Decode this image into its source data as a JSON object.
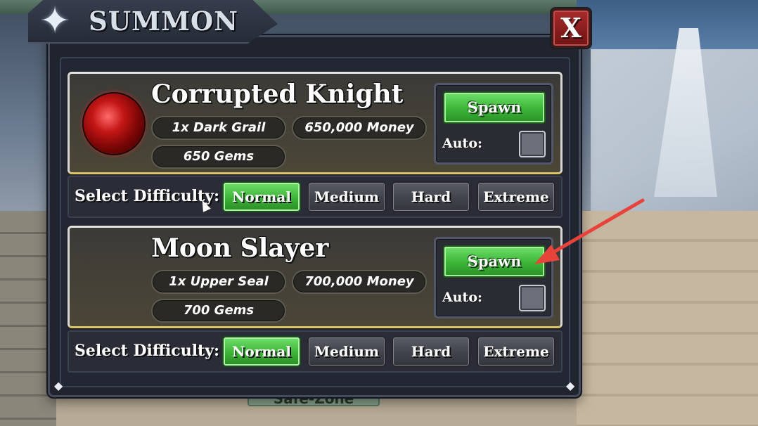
{
  "window": {
    "title": "SUMMON",
    "close_label": "X"
  },
  "bosses": [
    {
      "name": "Corrupted Knight",
      "requirement": "1x Dark Grail",
      "money": "650,000 Money",
      "gems": "650 Gems",
      "spawn_label": "Spawn",
      "auto_label": "Auto:",
      "auto_checked": false,
      "difficulty_label": "Select Difficulty:",
      "difficulties": [
        "Normal",
        "Medium",
        "Hard",
        "Extreme"
      ],
      "selected_difficulty": "Normal",
      "orb_color": "#c41616"
    },
    {
      "name": "Moon Slayer",
      "requirement": "1x Upper Seal",
      "money": "700,000 Money",
      "gems": "700 Gems",
      "spawn_label": "Spawn",
      "auto_label": "Auto:",
      "auto_checked": false,
      "difficulty_label": "Select Difficulty:",
      "difficulties": [
        "Normal",
        "Medium",
        "Hard",
        "Extreme"
      ],
      "selected_difficulty": "Normal"
    }
  ],
  "world": {
    "zone_sign": "Safe-Zone"
  },
  "colors": {
    "accent_green": "#3fb83a",
    "close_red": "#a82a2a",
    "card_border": "#d7c46a",
    "annotation_arrow": "#e8433a"
  },
  "icons": {
    "title": "four-point-star-icon",
    "corner": "diamond-icon",
    "annotation": "red-arrow-icon",
    "cursor": "mouse-cursor-icon"
  }
}
